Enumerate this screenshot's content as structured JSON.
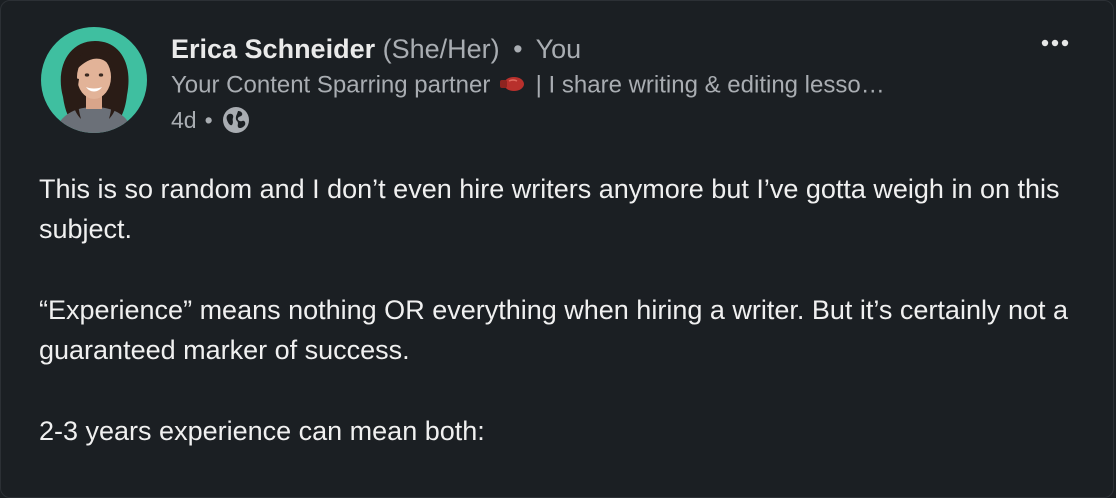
{
  "post": {
    "author": {
      "name": "Erica Schneider",
      "pronouns": "(She/Her)",
      "separator": "•",
      "relation": "You",
      "headline_prefix": "Your Content Sparring partner",
      "headline_suffix": "| I share writing & editing lesso…",
      "headline_emoji": "boxing-glove-icon"
    },
    "time": "4d",
    "time_separator": "•",
    "visibility_icon": "globe-icon",
    "menu_icon": "ellipsis-icon",
    "paragraphs": [
      "This is so random and I don’t even hire writers anymore but I’ve gotta weigh in on this subject.",
      "“Experience” means nothing OR everything when hiring a writer. But it’s certainly not a guaranteed marker of success.",
      "2-3 years experience can mean both:"
    ]
  },
  "colors": {
    "background": "#1b1f23",
    "primary_text": "#f0f0f0",
    "secondary_text": "#a9adb2",
    "avatar_bg": "#3fbfa0"
  }
}
